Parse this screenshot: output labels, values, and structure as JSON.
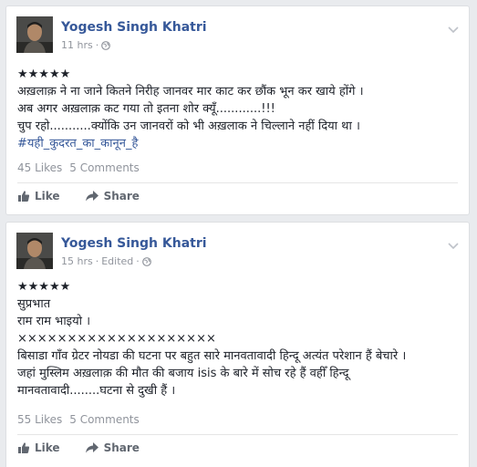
{
  "posts": [
    {
      "author": "Yogesh Singh Khatri",
      "time": "11 hrs",
      "edited": "",
      "body_lines": [
        "★★★★★",
        "अख़लाक़ ने ना जाने कितने निरीह जानवर मार काट कर छौंक भून कर खाये होंगे ।",
        "अब अगर अख़लाक़ कट गया तो इतना शोर क्यूँ............!!!",
        "चुप रहो...........क्योंकि उन जानवरों को भी अख़लाक ने चिल्लाने नहीं दिया था ।"
      ],
      "hashtag": "#यही_कुदरत_का_कानून_है",
      "likes": "45 Likes",
      "comments": "5 Comments",
      "like_label": "Like",
      "share_label": "Share"
    },
    {
      "author": "Yogesh Singh Khatri",
      "time": "15 hrs",
      "edited": "Edited",
      "body_lines": [
        "★★★★★",
        "सुप्रभात",
        "राम राम भाइयो ।",
        "××××××××××××××××××××",
        "बिसाडा गाँव ग्रेटर नोयडा की घटना पर बहुत सारे मानवतावादी हिन्दू अत्यंत परेशान हैं बेचारे ।",
        "जहां मुस्लिम अख़लाक़ की मौत की बजाय isis के बारे में सोच रहे हैं वहीँ हिन्दू",
        "मानवतावादी........घटना से दुखी हैं ।"
      ],
      "hashtag": "",
      "likes": "55 Likes",
      "comments": "5 Comments",
      "like_label": "Like",
      "share_label": "Share"
    }
  ],
  "meta_separator": "·",
  "colors": {
    "background": "#e9ebee",
    "author": "#365899",
    "meta": "#90949c",
    "text": "#1d2129",
    "action": "#616770"
  },
  "icons": {
    "privacy": "globe-icon",
    "menu": "chevron-down-icon",
    "like": "thumbs-up-icon",
    "share": "share-arrow-icon"
  }
}
